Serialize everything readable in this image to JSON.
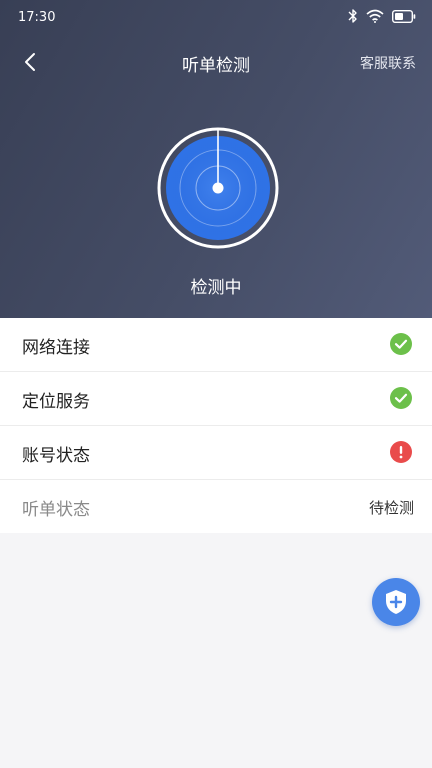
{
  "status_bar": {
    "time": "17:30"
  },
  "nav": {
    "title": "听单检测",
    "right_action": "客服联系"
  },
  "radar": {
    "label": "检测中"
  },
  "checks": [
    {
      "label": "网络连接",
      "status": "ok",
      "icon": "check-icon"
    },
    {
      "label": "定位服务",
      "status": "ok",
      "icon": "check-icon"
    },
    {
      "label": "账号状态",
      "status": "error",
      "icon": "exclamation-icon"
    },
    {
      "label": "听单状态",
      "status": "pending",
      "status_text": "待检测"
    }
  ],
  "colors": {
    "ok": "#6cc04a",
    "error": "#e94b4b",
    "accent": "#4a86e8"
  },
  "fab": {
    "icon": "shield-plus-icon"
  }
}
